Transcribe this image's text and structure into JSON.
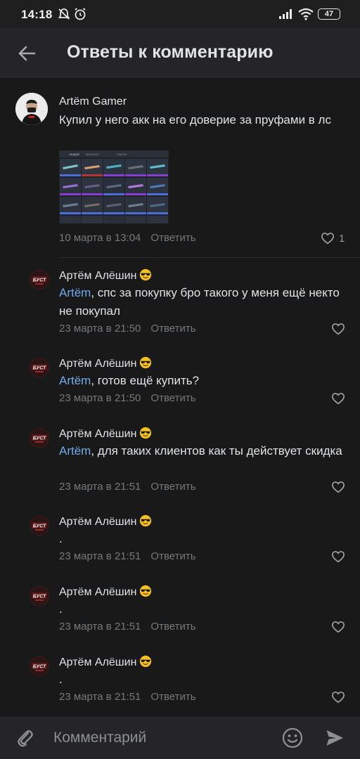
{
  "status_bar": {
    "time": "14:18",
    "battery": "47",
    "icons": [
      "do-not-disturb-icon",
      "alarm-icon",
      "signal-icon",
      "wifi-icon",
      "battery-icon"
    ]
  },
  "header": {
    "title": "Ответы к комментарию",
    "back_icon": "arrow-left-icon"
  },
  "root_comment": {
    "author": "Artëm Gamer",
    "text": "Купил у него акк на его доверие за пруфами в лс",
    "date": "10 марта в 13:04",
    "reply_label": "Ответить",
    "likes": "1",
    "attachment_tabs": [
      "ОБЩИЕ",
      "МАГАЗИН",
      "РЫНОК"
    ]
  },
  "replies": [
    {
      "author": "Артём Алёшин",
      "mention": "Artëm",
      "text": ", спс за покупку бро такого у меня ещё некто не покупал",
      "date": "23 марта в 21:50",
      "reply_label": "Ответить"
    },
    {
      "author": "Артём Алёшин",
      "mention": "Artëm",
      "text": ", готов ещё купить?",
      "date": "23 марта в 21:50",
      "reply_label": "Ответить"
    },
    {
      "author": "Артём Алёшин",
      "mention": "Artëm",
      "text": ", для таких клиентов как ты действует скидка",
      "date": "23 марта в 21:51",
      "reply_label": "Ответить"
    },
    {
      "author": "Артём Алёшин",
      "mention": "",
      "text": ".",
      "date": "23 марта в 21:51",
      "reply_label": "Ответить"
    },
    {
      "author": "Артём Алёшин",
      "mention": "",
      "text": ".",
      "date": "23 марта в 21:51",
      "reply_label": "Ответить"
    },
    {
      "author": "Артём Алёшин",
      "mention": "",
      "text": ".",
      "date": "23 марта в 21:51",
      "reply_label": "Ответить"
    }
  ],
  "reply_avatar_text": "БУСТ",
  "author_emoji": "smiling-face-with-sunglasses-icon",
  "composer": {
    "placeholder": "Комментарий",
    "attach_icon": "paperclip-icon",
    "emoji_icon": "smiley-icon",
    "send_icon": "send-icon"
  },
  "colors": {
    "background": "#19191a",
    "header": "#252527",
    "text": "#e1e3e6",
    "secondary_text": "#76787a",
    "mention": "#71aaeb"
  }
}
